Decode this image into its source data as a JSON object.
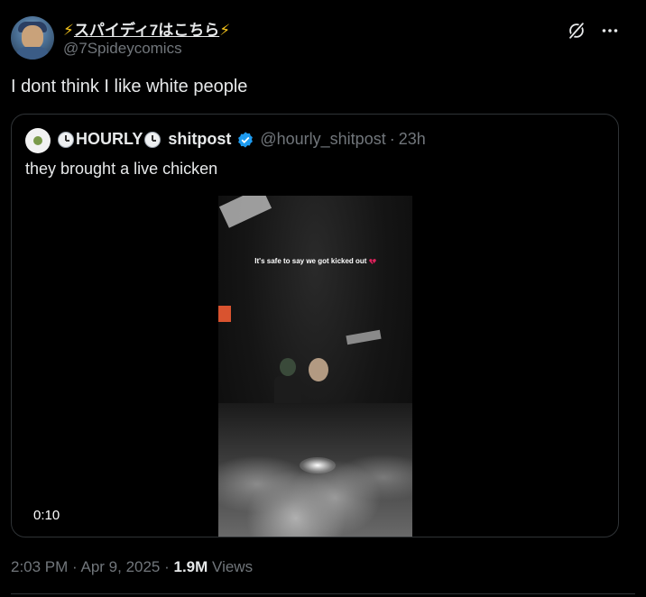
{
  "author": {
    "display_name_prefix": "⚡",
    "display_name_core": "スパイディ7はこちら",
    "display_name_suffix": "⚡",
    "handle": "@7Spideycomics"
  },
  "tweet": {
    "text": "I dont think I like white people"
  },
  "quoted_tweet": {
    "name_part1": "HOURLY",
    "name_part2": "shitpost",
    "handle": "@hourly_shitpost",
    "separator": "·",
    "time": "23h",
    "text": "they brought a live chicken",
    "video": {
      "caption": "It's safe to say we got kicked out",
      "duration": "0:10"
    }
  },
  "meta": {
    "time": "2:03 PM",
    "sep1": " · ",
    "date": "Apr 9, 2025",
    "sep2": " · ",
    "views_count": "1.9M",
    "views_label": "Views"
  },
  "icons": {
    "verified": "verified-badge-icon",
    "grok": "grok-icon",
    "more": "more-options-icon",
    "clock": "clock-emoji-icon",
    "heart": "broken-heart-icon"
  },
  "colors": {
    "background": "#000000",
    "text_primary": "#e7e9ea",
    "text_secondary": "#71767b",
    "border": "#2f3336",
    "verified_blue": "#1d9bf0",
    "lightning": "#f4c21a"
  }
}
